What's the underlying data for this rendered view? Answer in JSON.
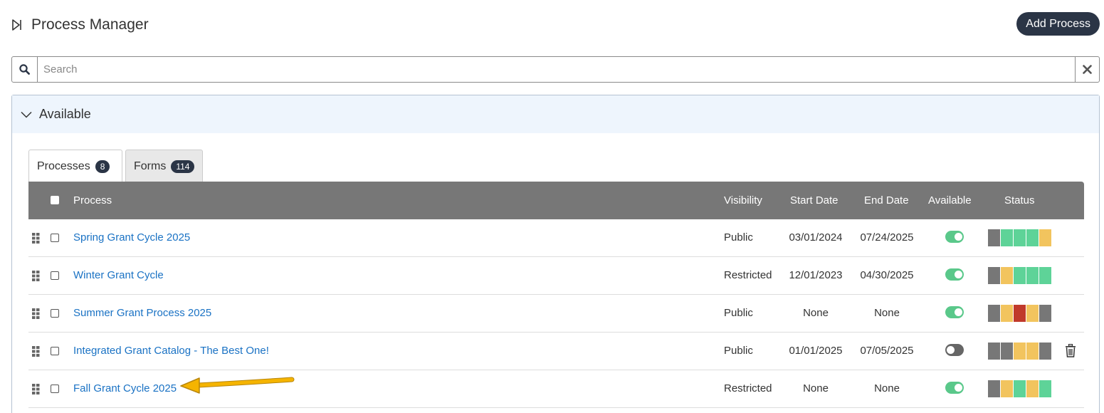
{
  "header": {
    "title": "Process Manager",
    "add_button": "Add Process"
  },
  "search": {
    "placeholder": "Search"
  },
  "panel": {
    "label": "Available"
  },
  "tabs": [
    {
      "label": "Processes",
      "count": "8"
    },
    {
      "label": "Forms",
      "count": "114"
    }
  ],
  "columns": {
    "process": "Process",
    "visibility": "Visibility",
    "start": "Start Date",
    "end": "End Date",
    "available": "Available",
    "status": "Status"
  },
  "colors": {
    "gray": "#777777",
    "green": "#5ed398",
    "yellow": "#f2c45e",
    "red": "#c0392b",
    "link": "#1a72c4",
    "dark": "#2b3546"
  },
  "rows": [
    {
      "name": "Spring Grant Cycle 2025",
      "visibility": "Public",
      "start": "03/01/2024",
      "end": "07/24/2025",
      "available": true,
      "status": [
        "gray",
        "green",
        "green",
        "green",
        "yellow"
      ],
      "trash": false
    },
    {
      "name": "Winter Grant Cycle",
      "visibility": "Restricted",
      "start": "12/01/2023",
      "end": "04/30/2025",
      "available": true,
      "status": [
        "gray",
        "yellow",
        "green",
        "green",
        "green"
      ],
      "trash": false
    },
    {
      "name": "Summer Grant Process 2025",
      "visibility": "Public",
      "start": "None",
      "end": "None",
      "available": true,
      "status": [
        "gray",
        "yellow",
        "red",
        "yellow",
        "gray"
      ],
      "trash": false
    },
    {
      "name": "Integrated Grant Catalog - The Best One!",
      "visibility": "Public",
      "start": "01/01/2025",
      "end": "07/05/2025",
      "available": false,
      "status": [
        "gray",
        "gray",
        "yellow",
        "yellow",
        "gray"
      ],
      "trash": true
    },
    {
      "name": "Fall Grant Cycle 2025",
      "visibility": "Restricted",
      "start": "None",
      "end": "None",
      "available": true,
      "status": [
        "gray",
        "yellow",
        "green",
        "yellow",
        "green"
      ],
      "trash": false
    }
  ]
}
